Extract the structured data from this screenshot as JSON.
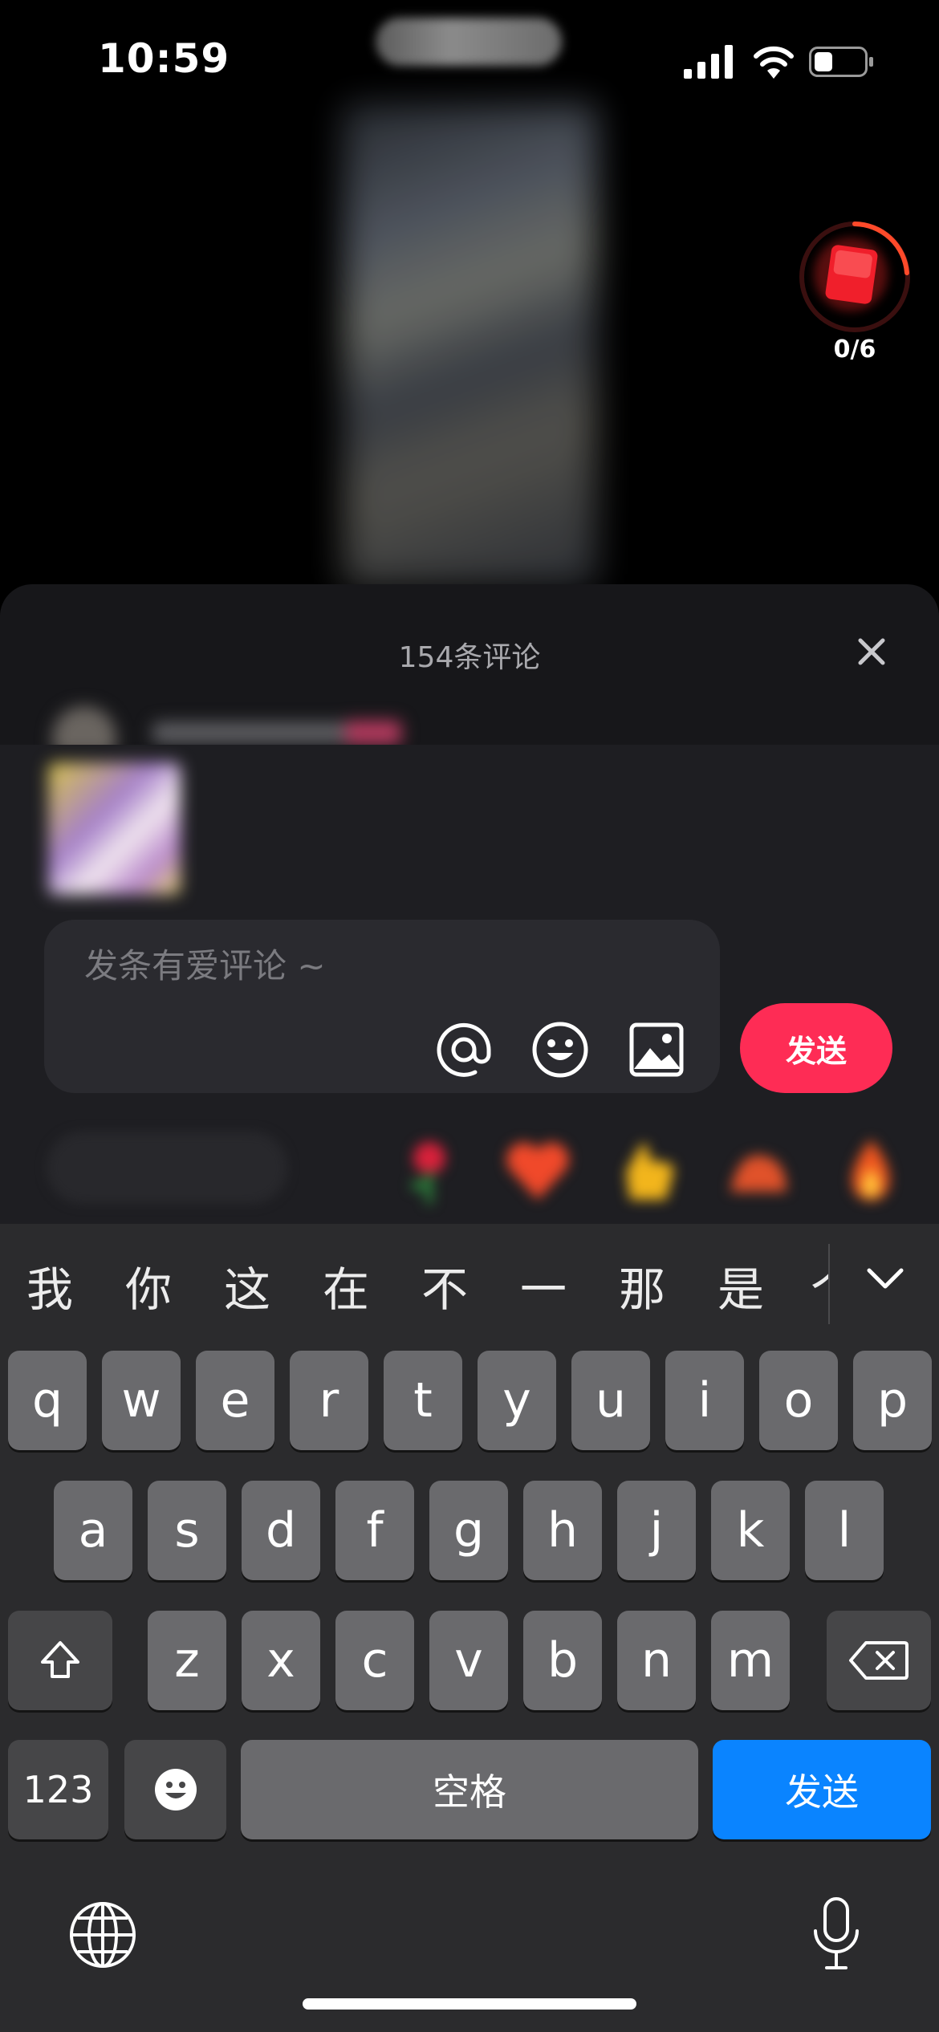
{
  "status_bar": {
    "time": "10:59"
  },
  "video": {
    "timer_progress": "0/6"
  },
  "comments": {
    "title": "154条评论",
    "input_placeholder": "发条有爱评论 ~",
    "send_label": "发送"
  },
  "keyboard": {
    "candidates": [
      "我",
      "你",
      "这",
      "在",
      "不",
      "一",
      "那",
      "是",
      "个"
    ],
    "row1": [
      "q",
      "w",
      "e",
      "r",
      "t",
      "y",
      "u",
      "i",
      "o",
      "p"
    ],
    "row2": [
      "a",
      "s",
      "d",
      "f",
      "g",
      "h",
      "j",
      "k",
      "l"
    ],
    "row3": [
      "z",
      "x",
      "c",
      "v",
      "b",
      "n",
      "m"
    ],
    "numbers_label": "123",
    "space_label": "空格",
    "return_label": "发送"
  },
  "colors": {
    "send_pink": "#fe2c55",
    "return_blue": "#0a84ff"
  }
}
